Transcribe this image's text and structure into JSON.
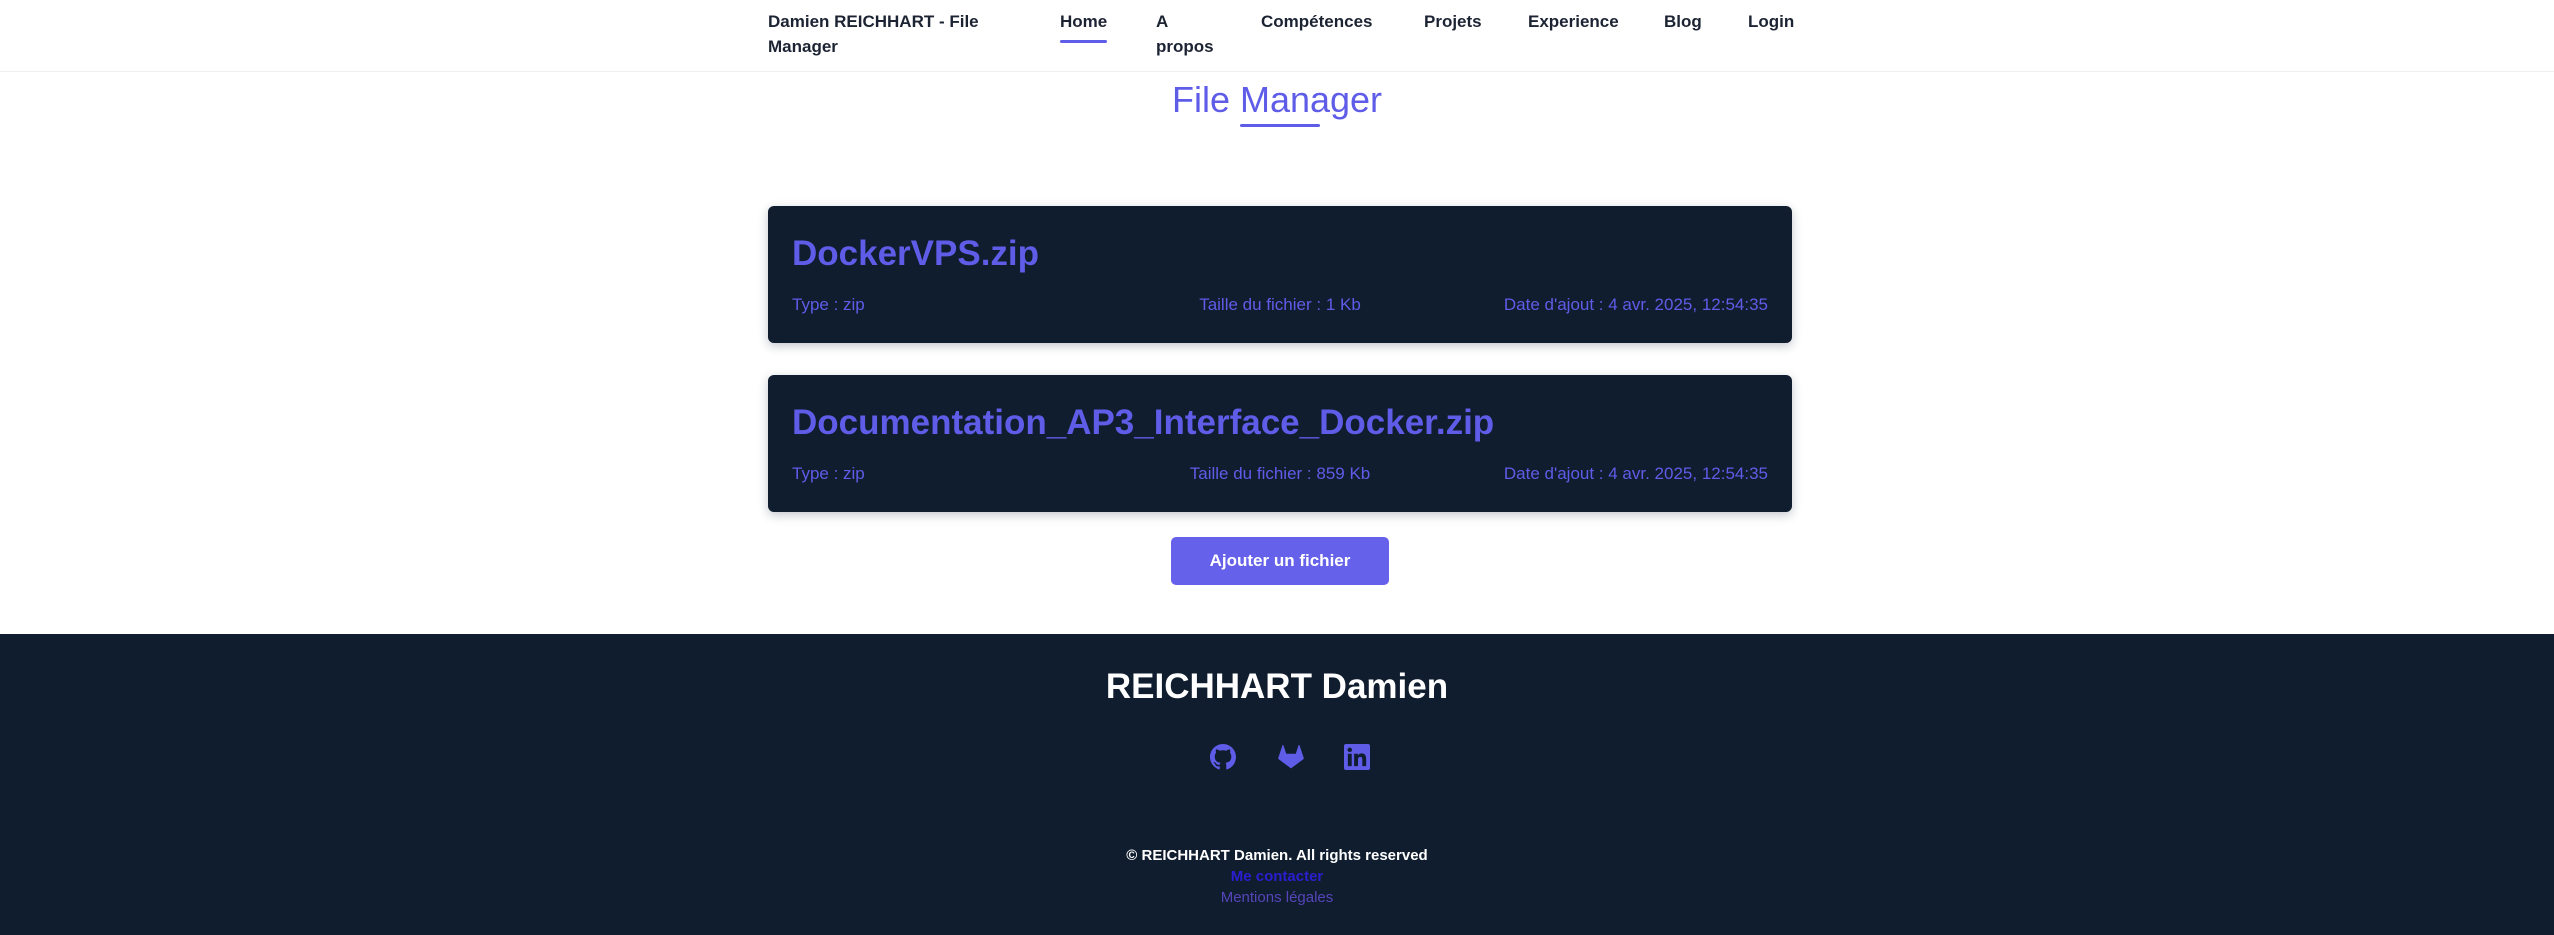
{
  "header": {
    "brand": "Damien REICHHART - File Manager",
    "nav": {
      "home": "Home",
      "apropos": "A propos",
      "competences": "Compétences",
      "projets": "Projets",
      "experience": "Experience",
      "blog": "Blog",
      "login": "Login"
    }
  },
  "page": {
    "title": "File Manager"
  },
  "files": [
    {
      "name": "DockerVPS.zip",
      "type": "Type : zip",
      "size": "Taille du fichier : 1 Kb",
      "date": "Date d'ajout : 4 avr. 2025, 12:54:35"
    },
    {
      "name": "Documentation_AP3_Interface_Docker.zip",
      "type": "Type : zip",
      "size": "Taille du fichier : 859 Kb",
      "date": "Date d'ajout : 4 avr. 2025, 12:54:35"
    }
  ],
  "actions": {
    "add_file": "Ajouter un fichier"
  },
  "footer": {
    "name": "REICHHART Damien",
    "social": [
      "github-icon",
      "gitlab-icon",
      "linkedin-icon"
    ],
    "copyright": "© REICHHART Damien. All rights reserved",
    "link_1": "Me contacter",
    "link_2": "Mentions légales"
  },
  "colors": {
    "accent": "#5f5ce8",
    "dark": "#101d2f",
    "button": "#6661ea"
  }
}
